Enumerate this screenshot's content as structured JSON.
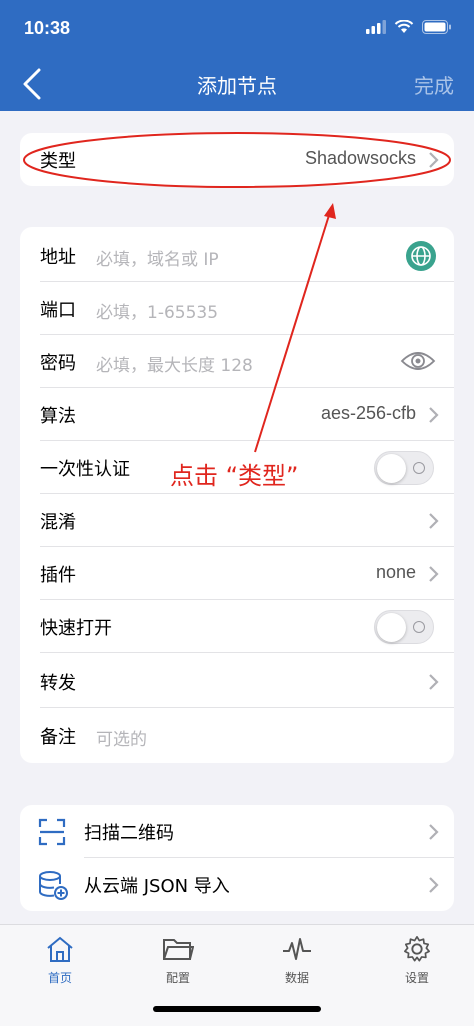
{
  "status_bar": {
    "time": "10:38"
  },
  "nav": {
    "title": "添加节点",
    "done": "完成"
  },
  "type_row": {
    "label": "类型",
    "value": "Shadowsocks"
  },
  "form": {
    "address": {
      "label": "地址",
      "placeholder": "必填，域名或 IP"
    },
    "port": {
      "label": "端口",
      "placeholder": "必填，1-65535"
    },
    "password": {
      "label": "密码",
      "placeholder": "必填，最大长度 128"
    },
    "algorithm": {
      "label": "算法",
      "value": "aes-256-cfb"
    },
    "one_time_auth": {
      "label": "一次性认证",
      "on": false
    },
    "obfs": {
      "label": "混淆"
    },
    "plugin": {
      "label": "插件",
      "value": "none"
    },
    "fast_open": {
      "label": "快速打开",
      "on": false
    },
    "forward": {
      "label": "转发"
    },
    "remark": {
      "label": "备注",
      "placeholder": "可选的"
    }
  },
  "actions": {
    "scan_qr": {
      "label": "扫描二维码"
    },
    "import_cloud": {
      "label": "从云端 JSON 导入"
    }
  },
  "annotation": {
    "text": "点击 “类型”"
  },
  "tabs": [
    {
      "label": "首页",
      "active": true
    },
    {
      "label": "配置",
      "active": false
    },
    {
      "label": "数据",
      "active": false
    },
    {
      "label": "设置",
      "active": false
    }
  ],
  "colors": {
    "accent": "#2f6cc2",
    "annotation": "#e0261e"
  }
}
